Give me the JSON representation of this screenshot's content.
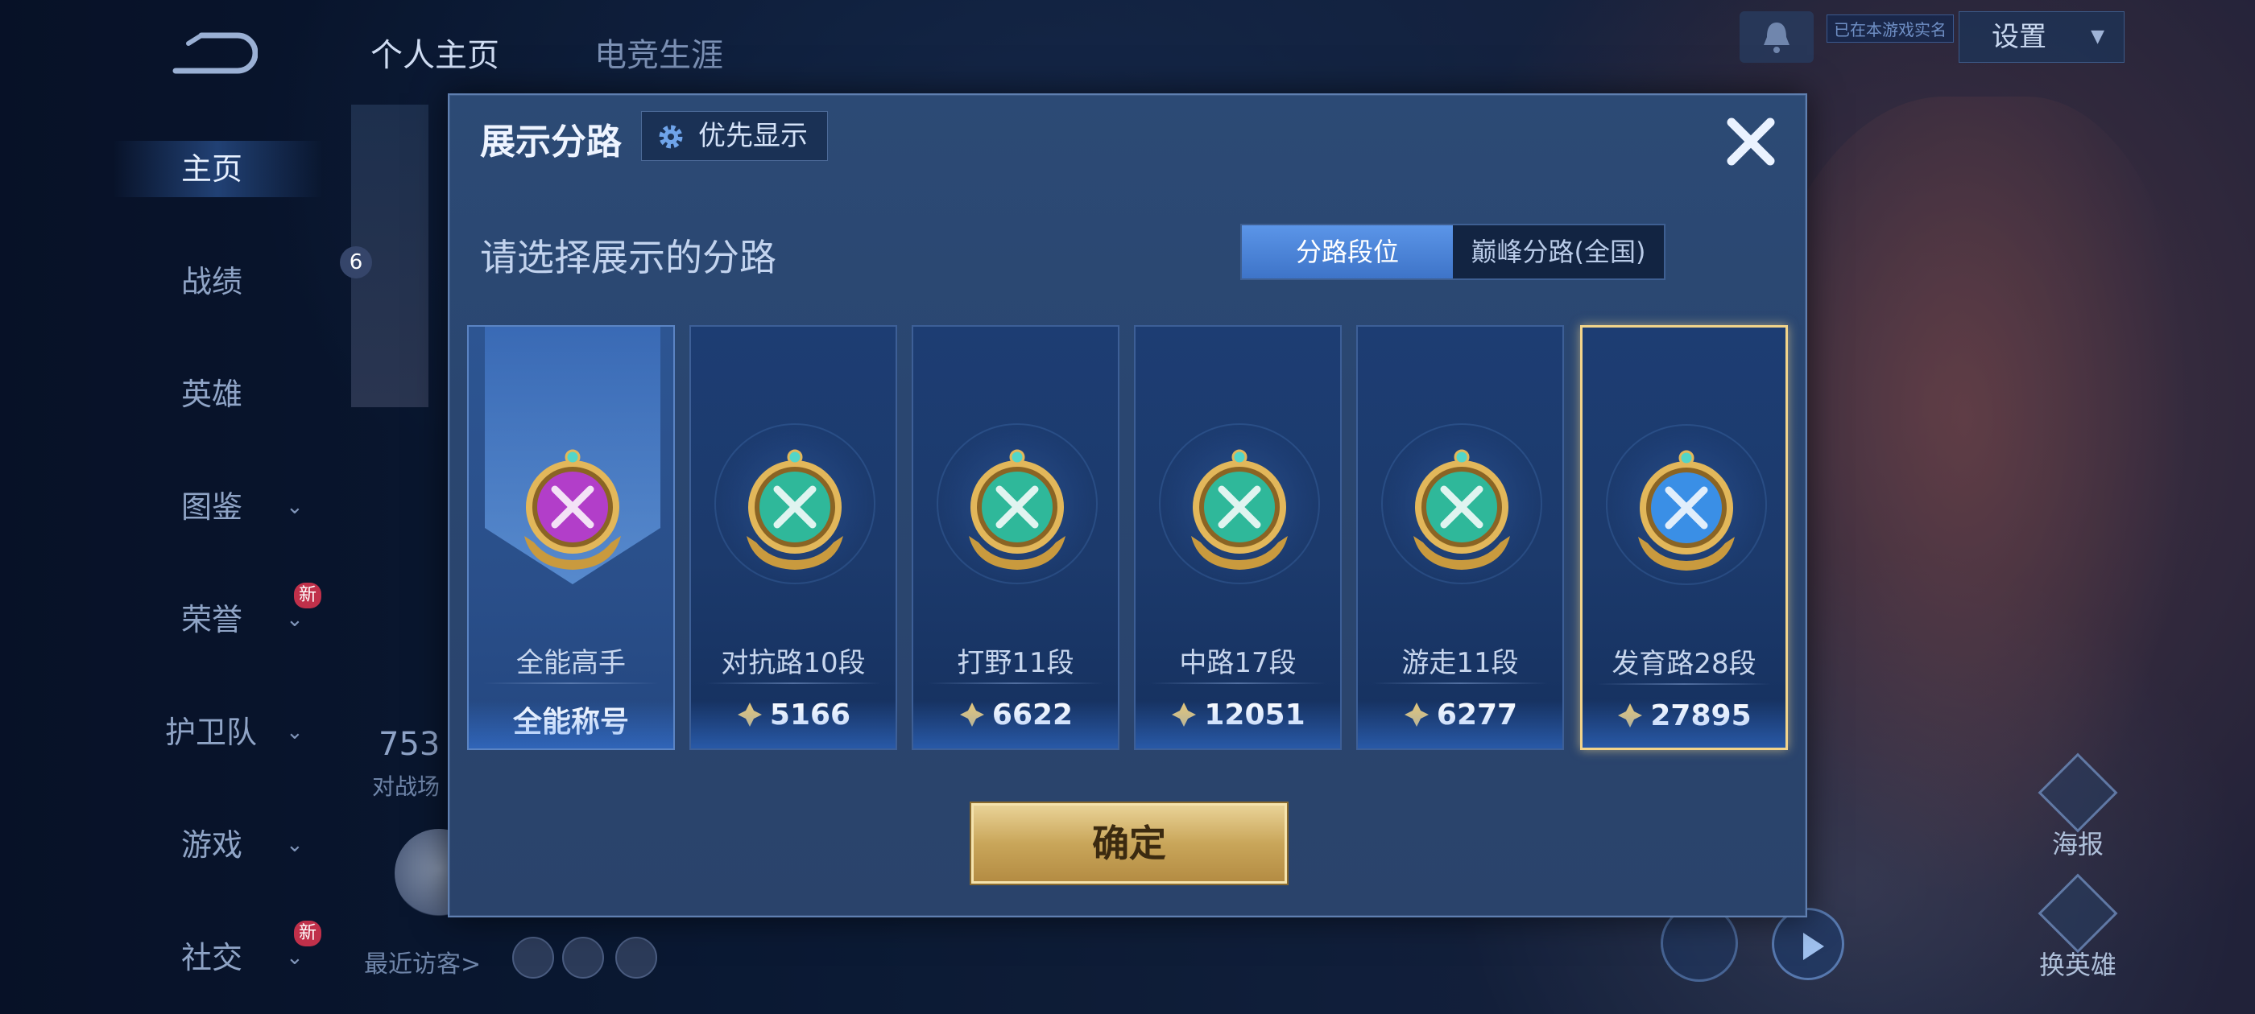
{
  "top_tabs": [
    "个人主页",
    "电竞生涯"
  ],
  "nav": {
    "items": [
      {
        "label": "主页",
        "chevron": false,
        "new": ""
      },
      {
        "label": "战绩",
        "chevron": false,
        "new": ""
      },
      {
        "label": "英雄",
        "chevron": false,
        "new": ""
      },
      {
        "label": "图鉴",
        "chevron": true,
        "new": ""
      },
      {
        "label": "荣誉",
        "chevron": true,
        "new": "新"
      },
      {
        "label": "护卫队",
        "chevron": true,
        "new": ""
      },
      {
        "label": "游戏",
        "chevron": true,
        "new": ""
      },
      {
        "label": "社交",
        "chevron": true,
        "new": "新"
      }
    ]
  },
  "header_right": {
    "status_tag": "已在本游戏实名",
    "settings_label": "设置"
  },
  "profile": {
    "level": "6",
    "stat_value": "753",
    "stat_label": "对战场",
    "recent_visitors_label": "最近访客>"
  },
  "side_buttons": [
    "海报",
    "换英雄"
  ],
  "modal": {
    "title": "展示分路",
    "priority_label": "优先显示",
    "subtitle": "请选择展示的分路",
    "segment": {
      "options": [
        "分路段位",
        "巅峰分路(全国)"
      ],
      "selected_index": 0
    },
    "cards": [
      {
        "name": "全能高手",
        "value": "全能称号",
        "color": "#b23ec9",
        "has_points": false,
        "selected": false
      },
      {
        "name": "对抗路10段",
        "value": "5166",
        "color": "#2fb89a",
        "has_points": true,
        "selected": false
      },
      {
        "name": "打野11段",
        "value": "6622",
        "color": "#2fb89a",
        "has_points": true,
        "selected": false
      },
      {
        "name": "中路17段",
        "value": "12051",
        "color": "#2fb89a",
        "has_points": true,
        "selected": false
      },
      {
        "name": "游走11段",
        "value": "6277",
        "color": "#2fb89a",
        "has_points": true,
        "selected": false
      },
      {
        "name": "发育路28段",
        "value": "27895",
        "color": "#3a8fe6",
        "has_points": true,
        "selected": true
      }
    ],
    "confirm_label": "确定"
  }
}
